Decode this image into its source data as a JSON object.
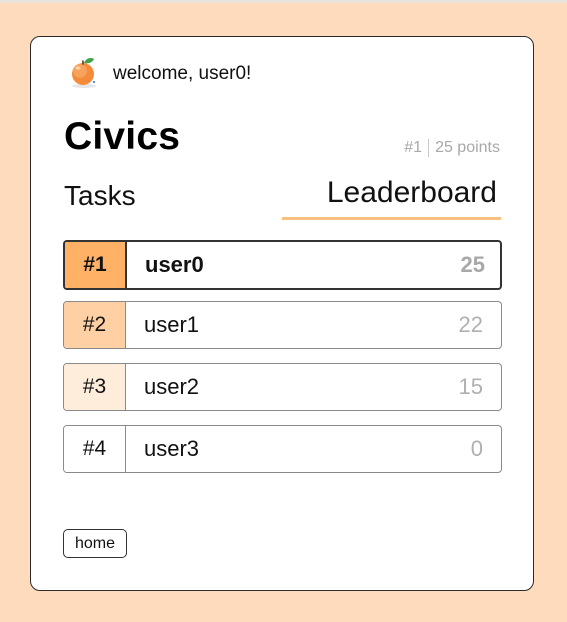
{
  "header": {
    "welcome_text": "welcome, user0!",
    "logo_icon": "orange-icon"
  },
  "page": {
    "title": "Civics",
    "rank_label": "#1",
    "points_label": "25 points"
  },
  "tabs": [
    {
      "label": "Tasks",
      "active": false
    },
    {
      "label": "Leaderboard",
      "active": true
    }
  ],
  "leaderboard": {
    "rows": [
      {
        "rank": "#1",
        "user": "user0",
        "points": "25",
        "rank_color": "#ffb266",
        "is_current_user": true
      },
      {
        "rank": "#2",
        "user": "user1",
        "points": "22",
        "rank_color": "#ffd0a3",
        "is_current_user": false
      },
      {
        "rank": "#3",
        "user": "user2",
        "points": "15",
        "rank_color": "#ffeddb",
        "is_current_user": false
      },
      {
        "rank": "#4",
        "user": "user3",
        "points": "0",
        "rank_color": "#ffffff",
        "is_current_user": false
      }
    ]
  },
  "footer": {
    "home_label": "home"
  },
  "colors": {
    "page_background": "#ffdbbd",
    "tab_underline": "#f9c17f"
  }
}
